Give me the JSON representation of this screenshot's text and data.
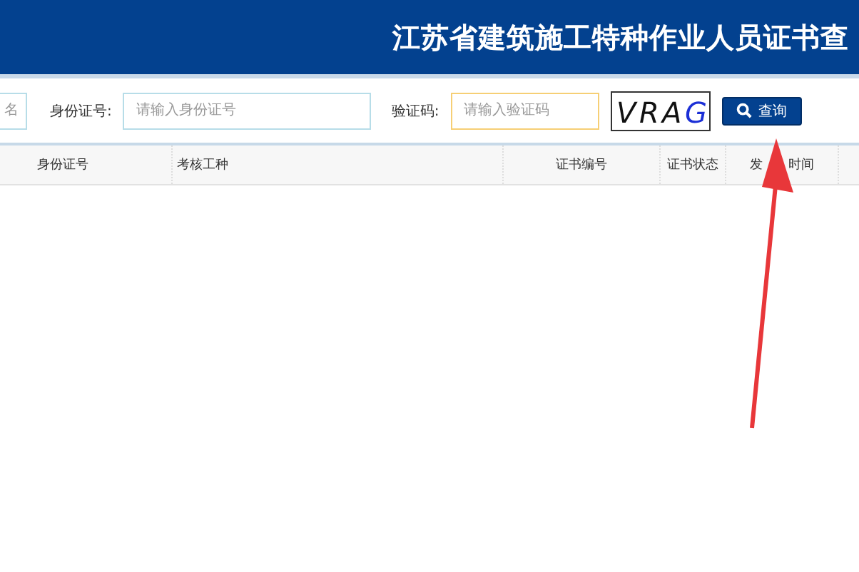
{
  "header": {
    "title": "江苏省建筑施工特种作业人员证书查"
  },
  "search": {
    "fields": [
      {
        "placeholder": "名",
        "kind": "plain"
      },
      {
        "label": "身份证号:",
        "placeholder": "请输入身份证号",
        "kind": "plain"
      },
      {
        "label": "验证码:",
        "placeholder": "请输入验证码",
        "kind": "captcha"
      }
    ],
    "captcha": "VRAG",
    "button": "查询"
  },
  "table": {
    "columns": [
      {
        "label": "身份证号"
      },
      {
        "label": "考核工种"
      },
      {
        "label": "证书编号"
      },
      {
        "label": "证书状态"
      },
      {
        "label_parts": [
          "发",
          "时间"
        ]
      },
      {}
    ]
  }
}
